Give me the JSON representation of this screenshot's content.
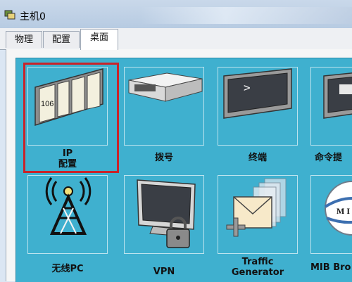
{
  "window": {
    "title": "主机0"
  },
  "tabs": [
    {
      "label": "物理",
      "active": false
    },
    {
      "label": "配置",
      "active": false
    },
    {
      "label": "桌面",
      "active": true
    }
  ],
  "desktop": {
    "apps": [
      {
        "label": "IP",
        "label2": "配置",
        "icon": "ip-config-icon",
        "icon_text": "106",
        "selected": true
      },
      {
        "label": "拨号",
        "icon": "dialup-modem-icon"
      },
      {
        "label": "终端",
        "icon": "terminal-icon",
        "icon_text": ">"
      },
      {
        "label": "命令提",
        "icon": "command-prompt-icon"
      },
      {
        "label": "无线PC",
        "icon": "wireless-antenna-icon"
      },
      {
        "label": "VPN",
        "icon": "vpn-monitor-lock-icon"
      },
      {
        "label": "Traffic",
        "label2": "Generator",
        "icon": "traffic-generator-icon"
      },
      {
        "label": "MIB Bro",
        "icon": "mib-browser-icon",
        "icon_text": "M I B"
      }
    ]
  },
  "colors": {
    "desktop_bg": "#3fb0cf",
    "selection": "#c9232a"
  }
}
